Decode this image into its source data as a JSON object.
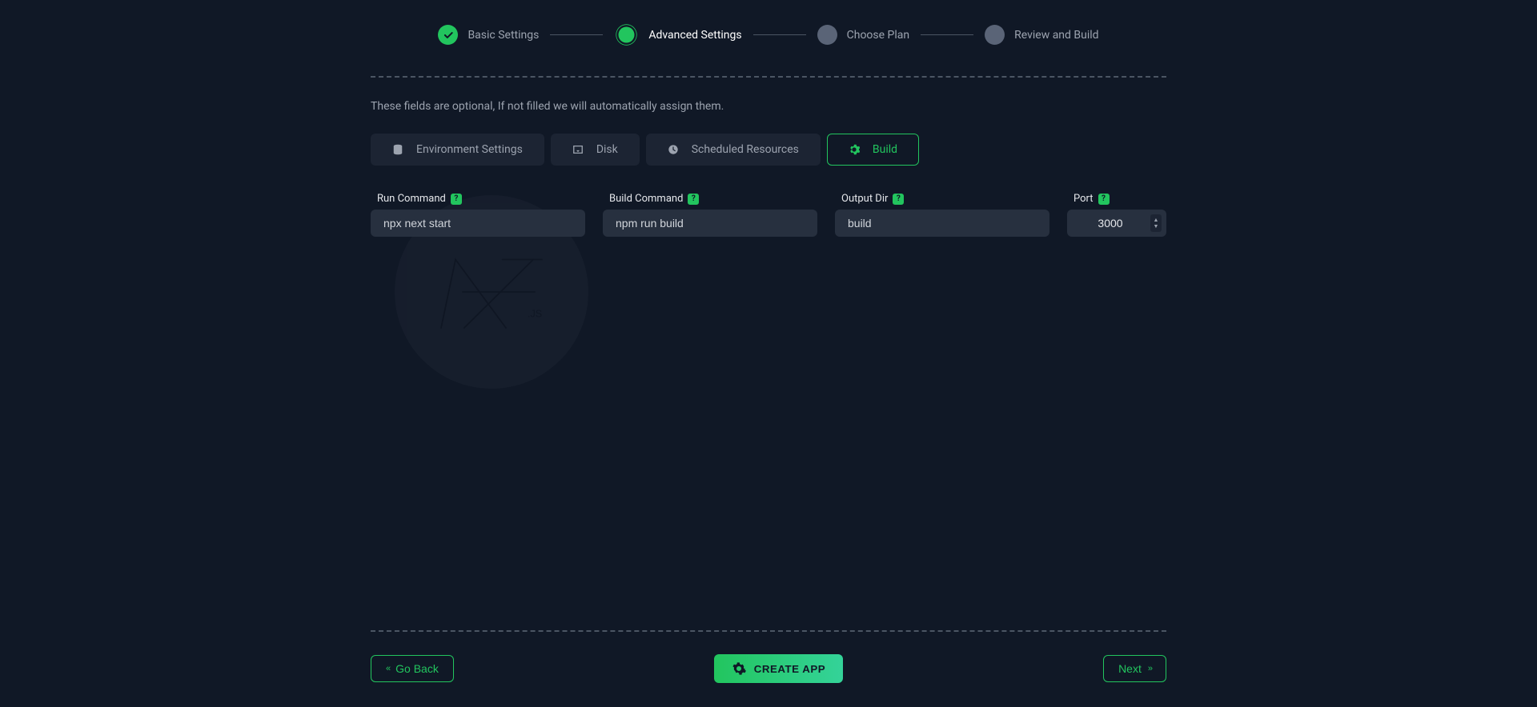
{
  "steps": {
    "basic": "Basic Settings",
    "advanced": "Advanced Settings",
    "plan": "Choose Plan",
    "review": "Review and Build"
  },
  "hint": "These fields are optional, If not filled we will automatically assign them.",
  "tabs": {
    "env": "Environment Settings",
    "disk": "Disk",
    "sched": "Scheduled Resources",
    "build": "Build"
  },
  "fields": {
    "run": {
      "label": "Run Command",
      "placeholder": "npx next start",
      "value": ""
    },
    "build": {
      "label": "Build Command",
      "placeholder": "npm run build",
      "value": ""
    },
    "output": {
      "label": "Output Dir",
      "placeholder": "build",
      "value": ""
    },
    "port": {
      "label": "Port",
      "value": "3000"
    }
  },
  "buttons": {
    "back": "Go Back",
    "create": "CREATE APP",
    "next": "Next"
  },
  "watermark": "NEXT.js",
  "help": "?"
}
